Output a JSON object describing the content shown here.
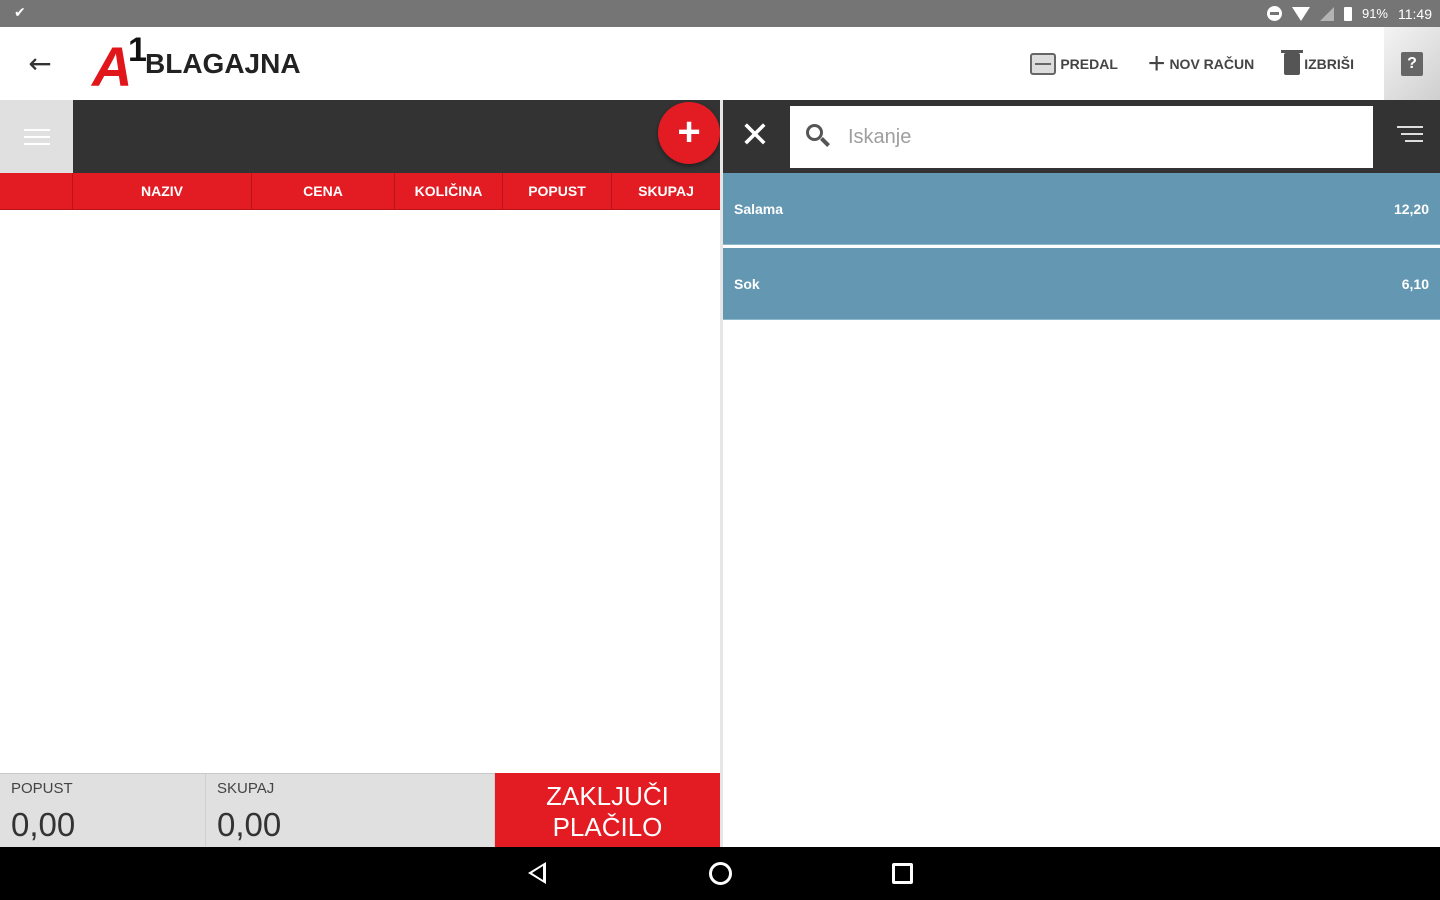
{
  "status_bar": {
    "battery": "91%",
    "time": "11:49"
  },
  "app_bar": {
    "logo_mark": "A",
    "logo_number": "1",
    "logo_text": "BLAGAJNA",
    "actions": {
      "drawer": "PREDAL",
      "new_receipt": "NOV RAČUN",
      "delete": "IZBRIŠI"
    }
  },
  "receipt_table": {
    "columns": [
      "NAZIV",
      "CENA",
      "KOLIČINA",
      "POPUST",
      "SKUPAJ"
    ],
    "rows": []
  },
  "footer": {
    "discount_label": "POPUST",
    "discount_value": "0,00",
    "total_label": "SKUPAJ",
    "total_value": "0,00",
    "pay_line1": "ZAKLJUČI",
    "pay_line2": "PLAČILO"
  },
  "search": {
    "placeholder": "Iskanje",
    "value": ""
  },
  "products": [
    {
      "name": "Salama",
      "price": "12,20"
    },
    {
      "name": "Sok",
      "price": "6,10"
    }
  ],
  "colors": {
    "accent_red": "#e31b23",
    "toolbar_dark": "#333333",
    "product_blue": "#6497b1"
  },
  "icons": [
    "back-arrow-icon",
    "cash-drawer-icon",
    "plus-icon",
    "trash-icon",
    "help-icon",
    "menu-icon",
    "add-icon",
    "close-icon",
    "search-icon",
    "sort-icon"
  ]
}
